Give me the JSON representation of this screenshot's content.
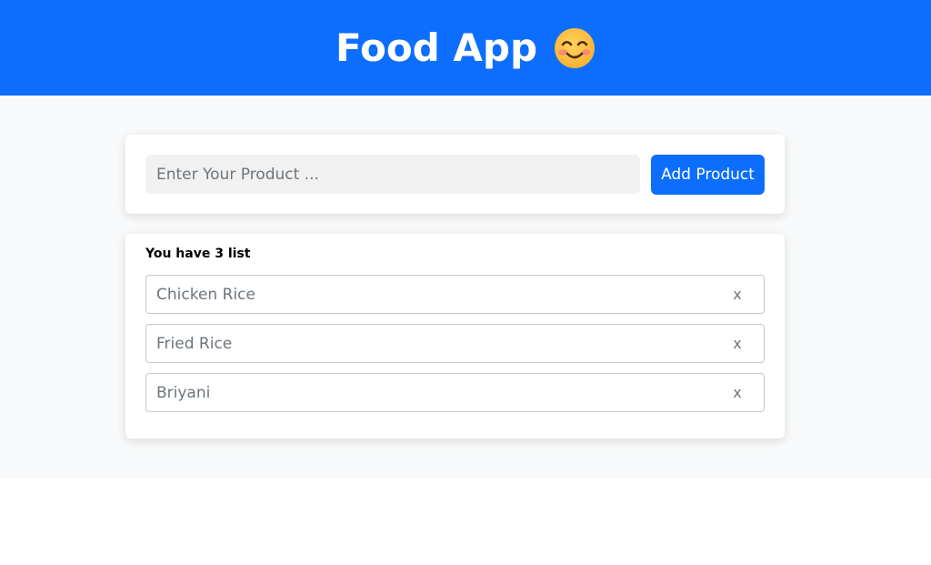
{
  "header": {
    "title": "Food App",
    "emoji_icon": "smiling-face-emoji"
  },
  "form": {
    "placeholder": "Enter Your Product ...",
    "value": "",
    "add_label": "Add Product"
  },
  "list": {
    "count_text": "You have 3 list",
    "items": [
      {
        "label": "Chicken Rice",
        "remove_label": "x"
      },
      {
        "label": "Fried Rice",
        "remove_label": "x"
      },
      {
        "label": "Briyani",
        "remove_label": "x"
      }
    ]
  },
  "colors": {
    "primary": "#0d6efd",
    "background": "#f8f9fa",
    "input_bg": "#f1f1f1"
  }
}
